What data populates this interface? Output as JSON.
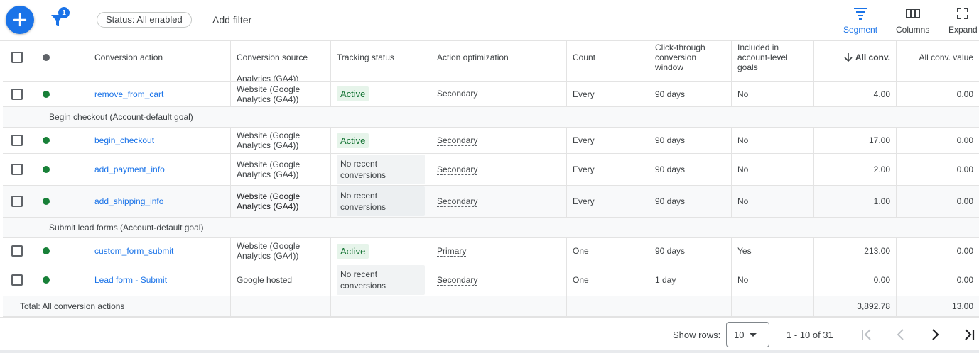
{
  "toolbar": {
    "add_icon": "plus-icon",
    "filter_icon": "filter-icon",
    "filter_count": "1",
    "status_chip": "Status: All enabled",
    "add_filter": "Add filter",
    "segment_label": "Segment",
    "columns_label": "Columns",
    "expand_label": "Expand",
    "accent_color": "#1a73e8"
  },
  "header": {
    "conversion_action": "Conversion action",
    "conversion_source": "Conversion source",
    "tracking_status": "Tracking status",
    "action_optimization": "Action optimization",
    "count": "Count",
    "ctw_line1": "Click-through",
    "ctw_line2": "conversion",
    "ctw_line3": "window",
    "included_line1": "Included in",
    "included_line2": "account-level",
    "included_line3": "goals",
    "all_conv": "All conv.",
    "all_conv_value": "All conv. value",
    "sort_icon": "arrow-down-icon"
  },
  "partial_row": {
    "source_fragment": "Analytics (GA4))"
  },
  "rows": [
    {
      "action": "remove_from_cart",
      "source1": "Website (Google",
      "source2": "Analytics (GA4))",
      "status": "Active",
      "optimization": "Secondary",
      "count": "Every",
      "window": "90 days",
      "included": "No",
      "all_conv": "4.00",
      "all_conv_value": "0.00"
    },
    {
      "action": "begin_checkout",
      "source1": "Website (Google",
      "source2": "Analytics (GA4))",
      "status": "Active",
      "optimization": "Secondary",
      "count": "Every",
      "window": "90 days",
      "included": "No",
      "all_conv": "17.00",
      "all_conv_value": "0.00"
    },
    {
      "action": "add_payment_info",
      "source1": "Website (Google",
      "source2": "Analytics (GA4))",
      "status1": "No recent",
      "status2": "conversions",
      "optimization": "Secondary",
      "count": "Every",
      "window": "90 days",
      "included": "No",
      "all_conv": "2.00",
      "all_conv_value": "0.00"
    },
    {
      "action": "add_shipping_info",
      "source1": "Website (Google",
      "source2": "Analytics (GA4))",
      "status1": "No recent",
      "status2": "conversions",
      "optimization": "Secondary",
      "count": "Every",
      "window": "90 days",
      "included": "No",
      "all_conv": "1.00",
      "all_conv_value": "0.00"
    },
    {
      "action": "custom_form_submit",
      "source1": "Website (Google",
      "source2": "Analytics (GA4))",
      "status": "Active",
      "optimization": "Primary",
      "count": "One",
      "window": "90 days",
      "included": "Yes",
      "all_conv": "213.00",
      "all_conv_value": "0.00"
    },
    {
      "action": "Lead form - Submit",
      "source": "Google hosted",
      "status1": "No recent",
      "status2": "conversions",
      "optimization": "Secondary",
      "count": "One",
      "window": "1 day",
      "included": "No",
      "all_conv": "0.00",
      "all_conv_value": "0.00"
    }
  ],
  "groups": {
    "begin_checkout": "Begin checkout (Account-default goal)",
    "submit_lead": "Submit lead forms (Account-default goal)"
  },
  "total": {
    "label": "Total: All conversion actions",
    "all_conv": "3,892.78",
    "all_conv_value": "13.00"
  },
  "pagination": {
    "show_rows_label": "Show rows:",
    "rows_value": "10",
    "range": "1 - 10 of 31"
  },
  "colors": {
    "status_active_bg": "#e6f4ea",
    "status_active_text": "#137333",
    "dot_enabled": "#188038",
    "link": "#1a73e8"
  }
}
